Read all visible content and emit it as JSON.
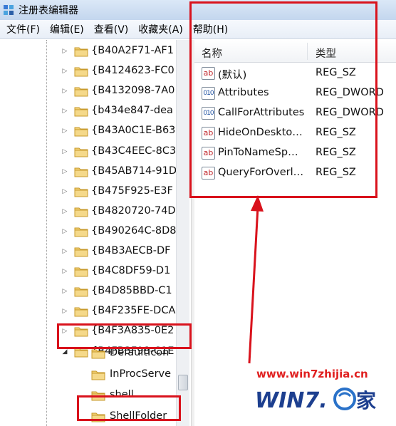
{
  "window": {
    "title": "注册表编辑器"
  },
  "menu": [
    {
      "label": "文件(F)"
    },
    {
      "label": "编辑(E)"
    },
    {
      "label": "查看(V)"
    },
    {
      "label": "收藏夹(A)"
    },
    {
      "label": "帮助(H)"
    }
  ],
  "tree": {
    "items": [
      {
        "label": "{B40A2F71-AF1",
        "expander": "collapsed"
      },
      {
        "label": "{B4124623-FC0",
        "expander": "collapsed"
      },
      {
        "label": "{B4132098-7A0",
        "expander": "collapsed"
      },
      {
        "label": "{b434e847-dea",
        "expander": "collapsed"
      },
      {
        "label": "{B43A0C1E-B63",
        "expander": "collapsed"
      },
      {
        "label": "{B43C4EEC-8C3",
        "expander": "collapsed"
      },
      {
        "label": "{B45AB714-91D",
        "expander": "collapsed"
      },
      {
        "label": "{B475F925-E3F",
        "expander": "collapsed"
      },
      {
        "label": "{B4820720-74D",
        "expander": "collapsed"
      },
      {
        "label": "{B490264C-8D8",
        "expander": "collapsed"
      },
      {
        "label": "{B4B3AECB-DF",
        "expander": "collapsed"
      },
      {
        "label": "{B4C8DF59-D1",
        "expander": "collapsed"
      },
      {
        "label": "{B4D85BBD-C1",
        "expander": "collapsed"
      },
      {
        "label": "{B4F235FE-DCA",
        "expander": "collapsed"
      },
      {
        "label": "{B4F3A835-0E2",
        "expander": "collapsed"
      },
      {
        "label": "{B4FB3F98-C1E",
        "expander": "expanded"
      }
    ],
    "children": [
      {
        "label": "DefaultIcon"
      },
      {
        "label": "InProcServe"
      },
      {
        "label": "shell"
      },
      {
        "label": "ShellFolder"
      }
    ]
  },
  "list": {
    "headers": {
      "name": "名称",
      "type": "类型"
    },
    "rows": [
      {
        "icon": "string-value-icon",
        "icon_text": "ab",
        "name": "(默认)",
        "type": "REG_SZ"
      },
      {
        "icon": "dword-value-icon",
        "icon_text": "010",
        "name": "Attributes",
        "type": "REG_DWORD"
      },
      {
        "icon": "dword-value-icon",
        "icon_text": "010",
        "name": "CallForAttributes",
        "type": "REG_DWORD"
      },
      {
        "icon": "string-value-icon",
        "icon_text": "ab",
        "name": "HideOnDeskto…",
        "type": "REG_SZ"
      },
      {
        "icon": "string-value-icon",
        "icon_text": "ab",
        "name": "PinToNameSp…",
        "type": "REG_SZ"
      },
      {
        "icon": "string-value-icon",
        "icon_text": "ab",
        "name": "QueryForOverl…",
        "type": "REG_SZ"
      }
    ]
  },
  "watermark": {
    "url": "www.win7zhijia.cn",
    "logo_text": "WIN7之家"
  },
  "colors": {
    "annotation": "#d9121c",
    "folder": "#e9c46a"
  }
}
